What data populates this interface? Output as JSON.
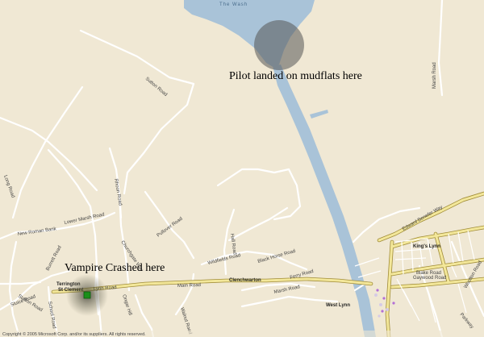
{
  "map": {
    "water_label": "The Wash",
    "copyright": "Copyright © 2005 Microsoft Corp. and/or its suppliers. All rights reserved.",
    "colors": {
      "land": "#f0e8d4",
      "water": "#a9c3d8",
      "road_minor": "#ffffff",
      "road_major": "#f3e79a",
      "marker_circle": "#555555",
      "marker_site": "#1a8f1a"
    }
  },
  "annotations": {
    "landing": "Pilot landed on mudflats here",
    "crash": "Vampire Crashed here"
  },
  "places": {
    "terrington_line1": "Terrington",
    "terrington_line2": "St Clement",
    "clenchwarton": "Clenchwarton",
    "west_lynn": "West Lynn",
    "kings_lynn": "King's Lynn"
  },
  "roads": {
    "sutton": "Sutton Road",
    "marsh": "Marsh Road",
    "long": "Long Road",
    "new_roman_bank": "New Roman Bank",
    "lower_marsh": "Lower Marsh Road",
    "rhoon": "Rhoon Road",
    "pullover": "Pullover Road",
    "church": "Churchgate Way",
    "station": "Station Road",
    "lynn": "Lynn Road",
    "main": "Main Road",
    "walnut": "Walnut Road",
    "hall": "Hall Road",
    "wildfields": "Wildfields Road",
    "ferry": "Ferry Road",
    "black_horse": "Black Horse Road",
    "edward_benefer": "Edward Benefer Way",
    "gaywood": "Gaywood Road",
    "wootton": "Wootton Road",
    "blake": "Blake Road",
    "parkway": "Parkway",
    "marsh_road_east": "Marsh Road",
    "ongar": "Ongar Hill",
    "burrett": "Burrett Road",
    "sluice": "Sluice Road",
    "school": "School Road"
  }
}
